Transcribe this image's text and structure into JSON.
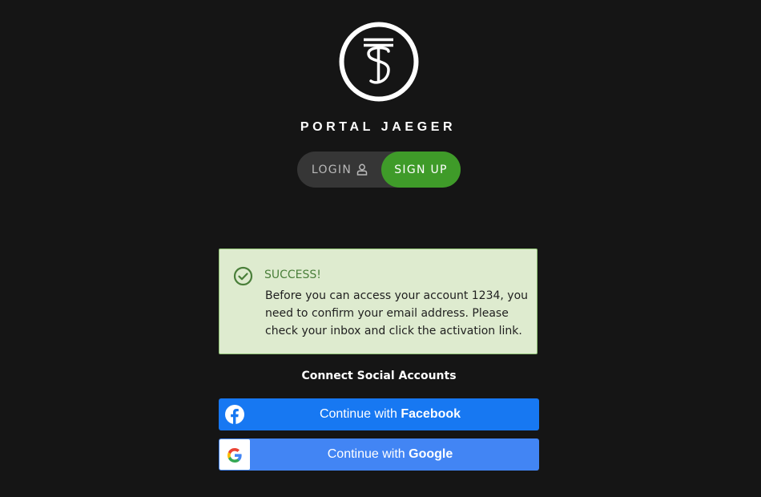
{
  "brand": {
    "name": "PORTAL JAEGER",
    "logo_icon": "ts-monogram-icon"
  },
  "auth_toggle": {
    "login_label": "LOGIN",
    "login_icon": "user-icon",
    "signup_label": "SIGN UP"
  },
  "alert": {
    "title": "SUCCESS!",
    "message": "Before you can access your account 1234, you need to confirm your email address. Please check your inbox and click the activation link.",
    "icon": "check-circle-icon"
  },
  "social": {
    "heading": "Connect Social Accounts",
    "facebook_prefix": "Continue with",
    "facebook_brand": "Facebook",
    "google_prefix": "Continue with",
    "google_brand": "Google"
  },
  "colors": {
    "background": "#151515",
    "signup": "#3f9b29",
    "facebook": "#1778f2",
    "google": "#4285f4",
    "alert_bg": "#deebcf",
    "alert_border": "#90c475",
    "alert_title": "#4a7f3a"
  }
}
